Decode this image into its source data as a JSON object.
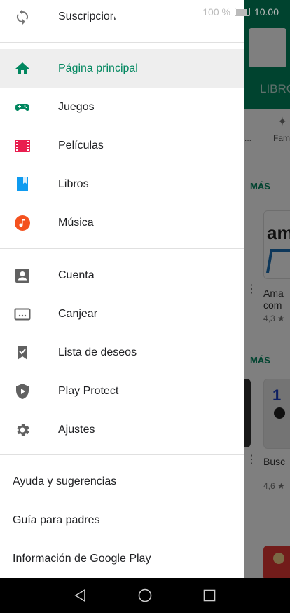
{
  "status_bar": {
    "battery_text": "100 %",
    "time": "10.00"
  },
  "drawer": {
    "top_item": {
      "label": "Suscripciones",
      "icon": "sync-icon"
    },
    "primary_items": [
      {
        "label": "Página principal",
        "icon": "home-icon",
        "color": "#01875f",
        "selected": true
      },
      {
        "label": "Juegos",
        "icon": "gamepad-icon",
        "color": "#01875f"
      },
      {
        "label": "Películas",
        "icon": "film-icon",
        "color": "#e91e4f"
      },
      {
        "label": "Libros",
        "icon": "book-icon",
        "color": "#0f9bf0"
      },
      {
        "label": "Música",
        "icon": "music-icon",
        "color": "#f4511e"
      }
    ],
    "secondary_items": [
      {
        "label": "Cuenta",
        "icon": "account-icon"
      },
      {
        "label": "Canjear",
        "icon": "redeem-icon"
      },
      {
        "label": "Lista de deseos",
        "icon": "wishlist-icon"
      },
      {
        "label": "Play Protect",
        "icon": "shield-icon"
      },
      {
        "label": "Ajustes",
        "icon": "gear-icon"
      }
    ],
    "text_items": [
      {
        "label": "Ayuda y sugerencias"
      },
      {
        "label": "Guía para padres"
      },
      {
        "label": "Información de Google Play"
      }
    ]
  },
  "background": {
    "tab_label": "LIBRO",
    "category_1": "...",
    "category_2": "Fam",
    "section_more_1": "MÁS",
    "section_more_2": "MÁS",
    "app_1_name_line1": "Ama",
    "app_1_name_line2": "com",
    "app_1_rating": "4,3 ★",
    "app_2_name": "Busc",
    "app_2_rating": "4,6 ★"
  },
  "colors": {
    "accent": "#01875f",
    "selected_bg": "#eeeeee"
  }
}
